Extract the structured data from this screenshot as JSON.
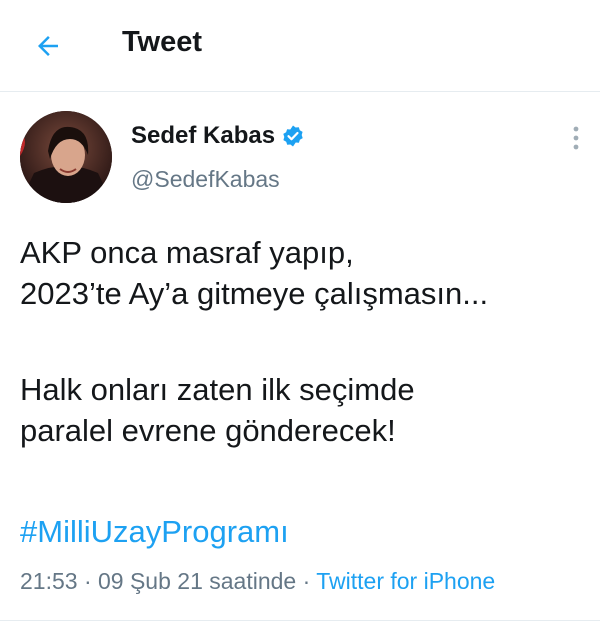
{
  "header": {
    "title": "Tweet",
    "back_icon": "arrow-left-icon"
  },
  "tweet": {
    "author_name": "Sedef Kabas",
    "handle": "@SedefKabas",
    "verified_icon": "verified-badge-icon",
    "lines": [
      "AKP onca masraf yapıp,",
      "2023’te Ay’a gitmeye çalışmasın...",
      "Halk onları zaten ilk seçimde",
      "paralel evrene gönderecek!"
    ],
    "hashtag": "#MilliUzayProgramı",
    "timestamp": "21:53 · 09 Şub 21 saatinde · ",
    "source": "Twitter for iPhone"
  },
  "colors": {
    "accent": "#1da1f2",
    "secondary_text": "#657786",
    "text": "#14171a",
    "divider": "#e6ecf0"
  }
}
